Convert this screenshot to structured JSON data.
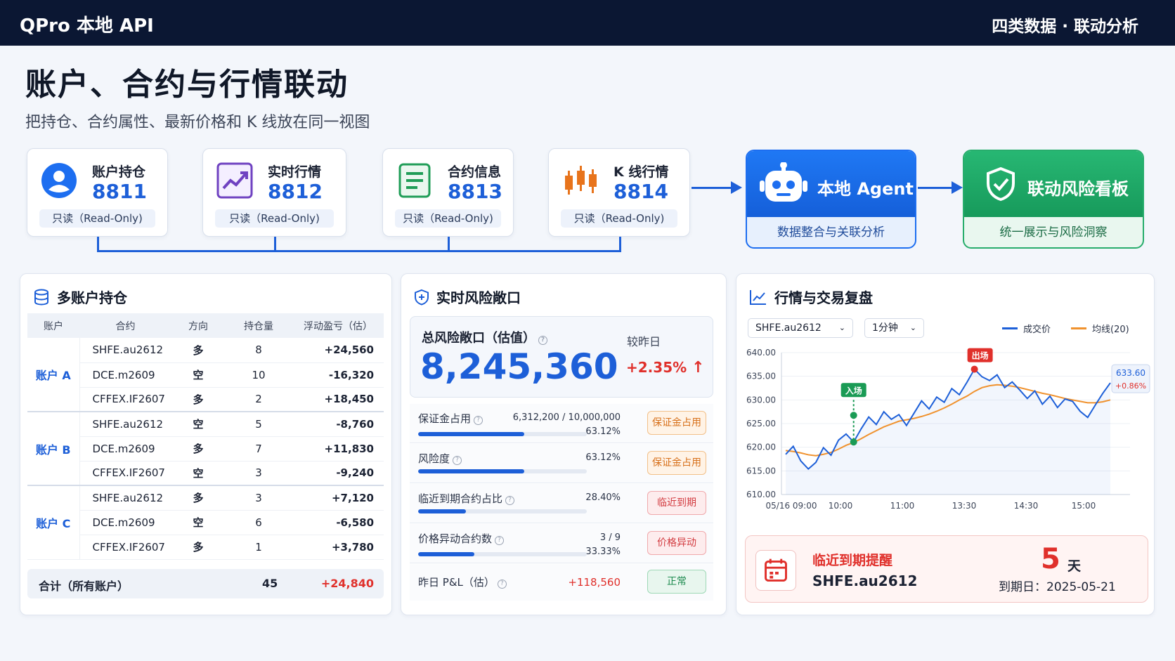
{
  "header": {
    "app_title": "QPro 本地 API",
    "tagline": "四类数据 · 联动分析"
  },
  "page": {
    "title": "账户、合约与行情联动",
    "subtitle": "把持仓、合约属性、最新价格和 K 线放在同一视图"
  },
  "sources": [
    {
      "name": "账户持仓",
      "port": "8811",
      "mode": "只读（Read-Only)",
      "icon": "account-user-icon"
    },
    {
      "name": "实时行情",
      "port": "8812",
      "mode": "只读（Read-Only)",
      "icon": "trend-chart-icon"
    },
    {
      "name": "合约信息",
      "port": "8813",
      "mode": "只读（Read-Only)",
      "icon": "document-icon"
    },
    {
      "name": "K 线行情",
      "port": "8814",
      "mode": "只读（Read-Only)",
      "icon": "candlestick-icon"
    }
  ],
  "agent": {
    "title": "本地 Agent",
    "desc": "数据整合与关联分析",
    "icon": "robot-icon"
  },
  "dashboard": {
    "title": "联动风险看板",
    "desc": "统一展示与风险洞察",
    "icon": "shield-check-icon"
  },
  "positions": {
    "title": "多账户持仓",
    "columns": [
      "账户",
      "合约",
      "方向",
      "持仓量",
      "浮动盈亏（估）"
    ],
    "accounts": [
      {
        "name": "账户 A",
        "rows": [
          {
            "contract": "SHFE.au2612",
            "side": "多",
            "qty": "8",
            "pnl": "+24,560"
          },
          {
            "contract": "DCE.m2609",
            "side": "空",
            "qty": "10",
            "pnl": "-16,320"
          },
          {
            "contract": "CFFEX.IF2607",
            "side": "多",
            "qty": "2",
            "pnl": "+18,450"
          }
        ]
      },
      {
        "name": "账户 B",
        "rows": [
          {
            "contract": "SHFE.au2612",
            "side": "空",
            "qty": "5",
            "pnl": "-8,760"
          },
          {
            "contract": "DCE.m2609",
            "side": "多",
            "qty": "7",
            "pnl": "+11,830"
          },
          {
            "contract": "CFFEX.IF2607",
            "side": "空",
            "qty": "3",
            "pnl": "-9,240"
          }
        ]
      },
      {
        "name": "账户 C",
        "rows": [
          {
            "contract": "SHFE.au2612",
            "side": "多",
            "qty": "3",
            "pnl": "+7,120"
          },
          {
            "contract": "DCE.m2609",
            "side": "空",
            "qty": "6",
            "pnl": "-6,580"
          },
          {
            "contract": "CFFEX.IF2607",
            "side": "多",
            "qty": "1",
            "pnl": "+3,780"
          }
        ]
      }
    ],
    "total": {
      "label": "合计（所有账户）",
      "qty": "45",
      "pnl": "+24,840"
    }
  },
  "risk": {
    "title": "实时风险敞口",
    "kpi_label": "总风险敞口（估值）",
    "kpi_value": "8,245,360",
    "compare_label": "较昨日",
    "compare_value": "+2.35%",
    "rows": [
      {
        "label": "保证金占用",
        "value": "6,312,200 / 10,000,000",
        "sub": "63.12%",
        "progress": 0.6312,
        "badge": "保证金占用",
        "badge_type": "warn"
      },
      {
        "label": "风险度",
        "value": "63.12%",
        "sub": "",
        "progress": 0.6312,
        "badge": "保证金占用",
        "badge_type": "warn"
      },
      {
        "label": "临近到期合约占比",
        "value": "28.40%",
        "sub": "",
        "progress": 0.284,
        "badge": "临近到期",
        "badge_type": "red"
      },
      {
        "label": "价格异动合约数",
        "value": "3 / 9",
        "sub": "33.33%",
        "progress": 0.3333,
        "badge": "价格异动",
        "badge_type": "red"
      }
    ],
    "pnl_row": {
      "label": "昨日 P&L（估）",
      "value": "+118,560",
      "badge": "正常"
    }
  },
  "market": {
    "title": "行情与交易复盘",
    "symbol_select": "SHFE.au2612",
    "interval_select": "1分钟",
    "legend": [
      {
        "name": "成交价",
        "color": "#1d5fd8"
      },
      {
        "name": "均线(20)",
        "color": "#f0922e"
      }
    ],
    "entry_label": "入场",
    "exit_label": "出场",
    "last_price": "633.60",
    "last_change": "+0.86%",
    "alert": {
      "title": "临近到期提醒",
      "contract": "SHFE.au2612",
      "days": "5",
      "days_unit": "天",
      "expiry": "到期日：2025-05-21"
    }
  },
  "chart_data": {
    "type": "line",
    "y_ticks": [
      "640.00",
      "635.00",
      "630.00",
      "625.00",
      "620.00",
      "615.00",
      "610.00"
    ],
    "x_ticks": [
      "05/16 09:00",
      "10:00",
      "11:00",
      "13:30",
      "14:30",
      "15:00"
    ],
    "ylim": [
      610,
      640
    ],
    "series": [
      {
        "name": "成交价",
        "values": [
          618.5,
          620.2,
          617.1,
          615.4,
          616.8,
          619.9,
          618.3,
          621.5,
          622.8,
          621.1,
          623.9,
          626.4,
          624.8,
          627.5,
          625.9,
          626.9,
          624.6,
          627.2,
          629.8,
          628.1,
          630.6,
          629.5,
          632.4,
          631.1,
          633.7,
          636.5,
          634.9,
          634.1,
          635.3,
          632.6,
          633.8,
          632.1,
          630.3,
          631.9,
          629.1,
          630.8,
          628.4,
          630.2,
          629.7,
          627.6,
          626.3,
          628.9,
          631.4,
          633.6
        ]
      },
      {
        "name": "均线(20)",
        "values": [
          619.3,
          619.1,
          618.8,
          618.4,
          618.2,
          618.5,
          618.9,
          619.6,
          620.4,
          621.0,
          621.8,
          622.7,
          623.5,
          624.3,
          624.9,
          625.5,
          625.8,
          626.1,
          626.5,
          627.0,
          627.6,
          628.3,
          629.1,
          630.0,
          630.8,
          631.8,
          632.6,
          633.0,
          633.2,
          633.1,
          632.9,
          632.6,
          632.2,
          631.8,
          631.4,
          631.1,
          630.7,
          630.3,
          630.0,
          629.7,
          629.4,
          629.4,
          629.6,
          630.0
        ]
      }
    ],
    "entry_index": 9,
    "exit_index": 25
  }
}
